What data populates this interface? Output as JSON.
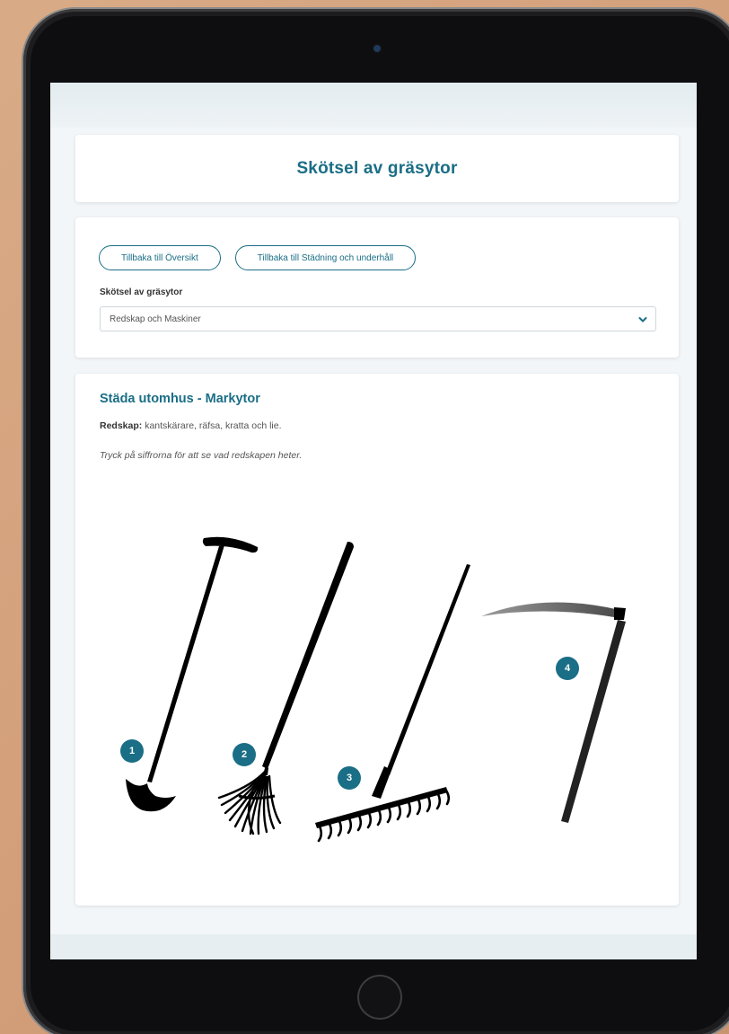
{
  "header": {
    "title": "Skötsel av gräsytor"
  },
  "nav": {
    "buttons": [
      {
        "label": "Tillbaka till Översikt"
      },
      {
        "label": "Tillbaka till Städning och underhåll"
      }
    ],
    "select_label": "Skötsel av gräsytor",
    "select_value": "Redskap och Maskiner"
  },
  "content": {
    "section_title": "Städa utomhus - Markytor",
    "tools_label": "Redskap:",
    "tools_text": "kantskärare, räfsa, kratta och lie.",
    "hint": "Tryck på siffrorna för att se vad redskapen heter.",
    "hotspots": [
      {
        "number": "1"
      },
      {
        "number": "2"
      },
      {
        "number": "3"
      },
      {
        "number": "4"
      }
    ]
  },
  "colors": {
    "accent": "#1a6e86",
    "background_wood": "#d4a07c",
    "device": "#1c1c1e"
  }
}
